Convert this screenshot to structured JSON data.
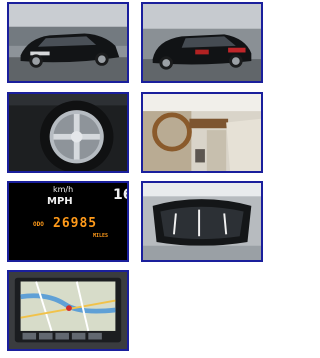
{
  "gallery": {
    "thumbnails": [
      {
        "id": "front-exterior"
      },
      {
        "id": "rear-exterior"
      },
      {
        "id": "wheel"
      },
      {
        "id": "interior"
      },
      {
        "id": "instrument-cluster"
      },
      {
        "id": "sunroof"
      },
      {
        "id": "navigation"
      }
    ]
  },
  "instrument_cluster": {
    "unit_top": "km/h",
    "unit_main": "MPH",
    "corner_value": "16",
    "odometer": "26985",
    "odo_prefix": "ODO",
    "odo_suffix": "MILES"
  },
  "colors": {
    "border": "#1a1f9c",
    "odometer": "#ff9a1a"
  }
}
